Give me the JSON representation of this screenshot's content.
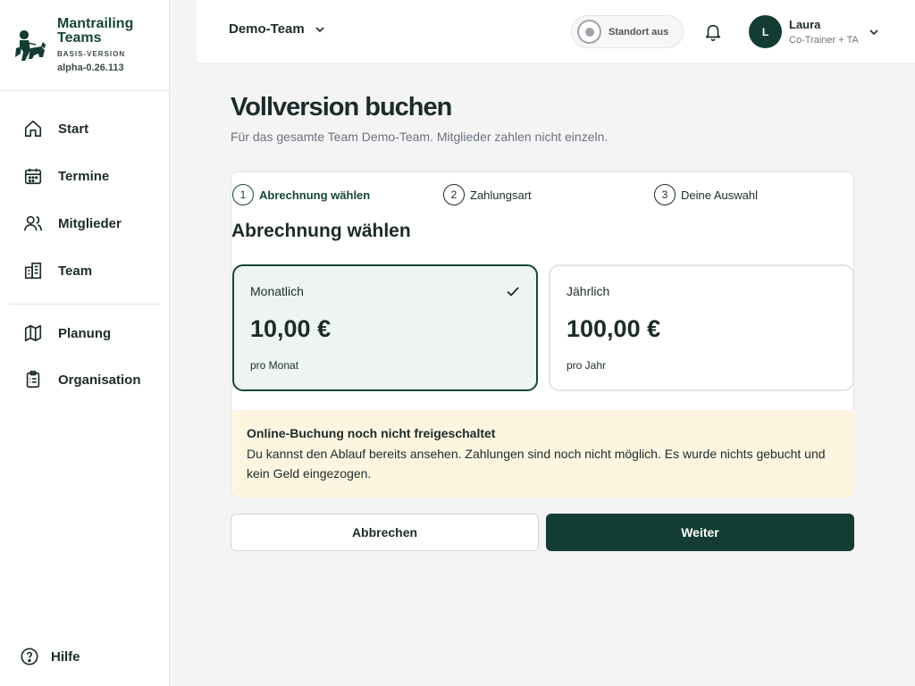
{
  "brand": {
    "name": "Mantrailing Teams",
    "version_label": "BASIS-VERSION",
    "build": "alpha-0.26.113"
  },
  "sidebar": {
    "items": [
      {
        "label": "Start",
        "icon": "home-icon"
      },
      {
        "label": "Termine",
        "icon": "calendar-icon"
      },
      {
        "label": "Mitglieder",
        "icon": "users-icon"
      },
      {
        "label": "Team",
        "icon": "building-icon"
      },
      {
        "label": "Planung",
        "icon": "map-icon"
      },
      {
        "label": "Organisation",
        "icon": "clipboard-icon"
      }
    ],
    "help_label": "Hilfe"
  },
  "topbar": {
    "team_name": "Demo-Team",
    "location_label": "Standort aus",
    "user": {
      "initial": "L",
      "name": "Laura",
      "role": "Co-Trainer + TA"
    }
  },
  "main": {
    "title": "Vollversion buchen",
    "subtitle": "Für das gesamte Team Demo-Team. Mitglieder zahlen nicht einzeln.",
    "steps": [
      {
        "number": "1",
        "label": "Abrechnung wählen",
        "active": true
      },
      {
        "number": "2",
        "label": "Zahlungsart",
        "active": false
      },
      {
        "number": "3",
        "label": "Deine Auswahl",
        "active": false
      }
    ],
    "section_title": "Abrechnung wählen",
    "options": [
      {
        "label": "Monatlich",
        "price": "10,00 €",
        "period": "pro Monat",
        "selected": true
      },
      {
        "label": "Jährlich",
        "price": "100,00 €",
        "period": "pro Jahr",
        "selected": false
      }
    ],
    "notice": {
      "title": "Online-Buchung noch nicht freigeschaltet",
      "text": "Du kannst den Ablauf bereits ansehen. Zahlungen sind noch nicht möglich. Es wurde nichts gebucht und kein Geld eingezogen."
    },
    "buttons": {
      "cancel": "Abbrechen",
      "next": "Weiter"
    }
  },
  "colors": {
    "brand_dark_green": "#133d33",
    "selected_bg": "#eef5f1",
    "notice_bg": "#fef5e1"
  }
}
